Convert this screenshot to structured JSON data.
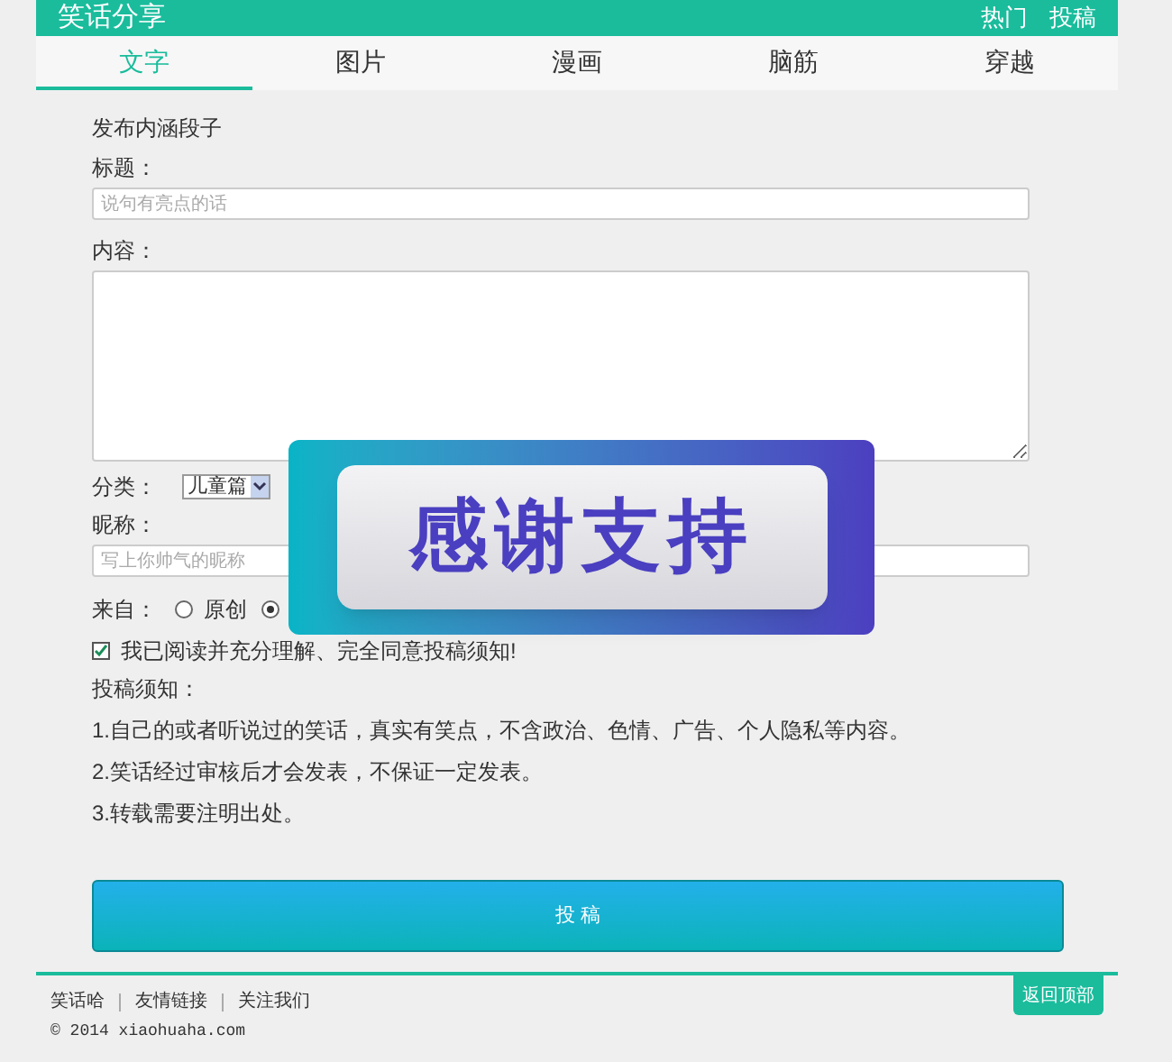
{
  "header": {
    "title": "笑话分享",
    "links": [
      "热门",
      "投稿"
    ]
  },
  "tabs": [
    {
      "label": "文字",
      "selected": true
    },
    {
      "label": "图片",
      "selected": false
    },
    {
      "label": "漫画",
      "selected": false
    },
    {
      "label": "脑筋",
      "selected": false
    },
    {
      "label": "穿越",
      "selected": false
    }
  ],
  "form": {
    "heading": "发布内涵段子",
    "title_label": "标题：",
    "title_field": {
      "placeholder": "说句有亮点的话"
    },
    "content_label": "内容：",
    "category_label": "分类：",
    "category_value": "儿童篇",
    "nickname_label": "昵称：",
    "nickname_field": {
      "placeholder": "写上你帅气的昵称"
    },
    "source_label": "来自：",
    "source_options": [
      {
        "label": "原创",
        "selected": false
      },
      {
        "selected": true
      }
    ],
    "agree": {
      "label": "我已阅读并充分理解、完全同意投稿须知!",
      "checked": true
    },
    "notice_title": "投稿须知：",
    "notices": [
      "1.自己的或者听说过的笑话，真实有笑点，不含政治、色情、广告、个人隐私等内容。",
      "2.笑话经过审核后才会发表，不保证一定发表。",
      "3.转载需要注明出处。"
    ],
    "submit": "投 稿"
  },
  "overlay": {
    "text": "感谢支持"
  },
  "footer": {
    "links": [
      "笑话哈",
      "友情链接",
      "关注我们"
    ],
    "copyright": "© 2014 xiaohuaha.com",
    "back_to_top": "返回顶部"
  }
}
